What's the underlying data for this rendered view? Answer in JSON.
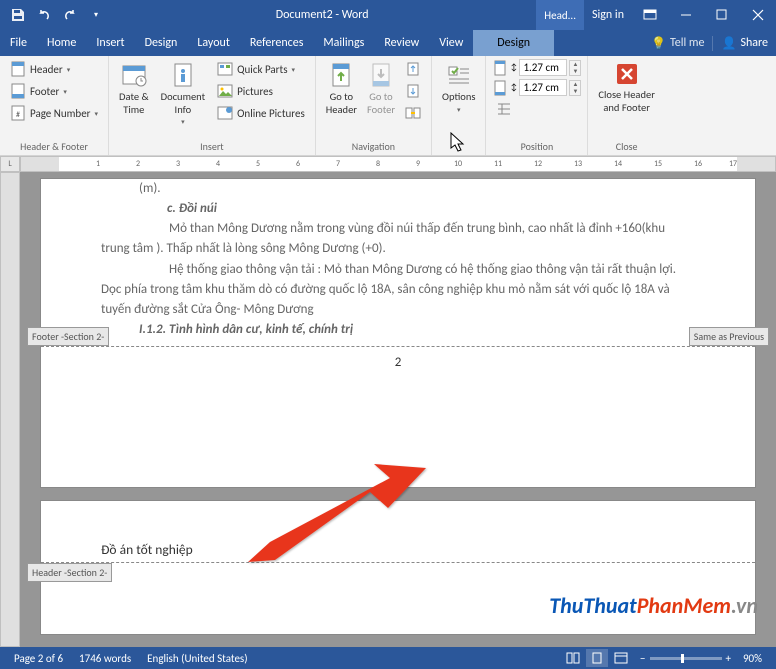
{
  "titlebar": {
    "document_title": "Document2 - Word",
    "contextual_tab": "Head...",
    "sign_in": "Sign in"
  },
  "menu": {
    "file": "File",
    "home": "Home",
    "insert": "Insert",
    "design": "Design",
    "layout": "Layout",
    "references": "References",
    "mailings": "Mailings",
    "review": "Review",
    "view": "View",
    "hf_design": "Design",
    "tell_me": "Tell me",
    "share": "Share"
  },
  "ribbon": {
    "hf": {
      "header": "Header",
      "footer": "Footer",
      "page_number": "Page Number",
      "group": "Header & Footer"
    },
    "insert": {
      "date_time": "Date &\nTime",
      "doc_info": "Document\nInfo",
      "quick_parts": "Quick Parts",
      "pictures": "Pictures",
      "online_pictures": "Online Pictures",
      "group": "Insert"
    },
    "nav": {
      "goto_header": "Go to\nHeader",
      "goto_footer": "Go to\nFooter",
      "group": "Navigation"
    },
    "options": {
      "label": "Options",
      "group": ""
    },
    "position": {
      "top": "1.27 cm",
      "bottom": "1.27 cm",
      "group": "Position"
    },
    "close": {
      "label": "Close Header\nand Footer",
      "group": "Close"
    }
  },
  "document": {
    "body": {
      "line_m": "(m).",
      "heading_c": "c. Đồi núi",
      "para1": "Mỏ than Mông Dương nằm trong vùng đồi núi thấp đến trung bình, cao nhất là đỉnh +160(khu trung tâm ). Thấp nhất là lòng sông Mông Dương (+0).",
      "para2": "Hệ thống giao thông vận tải : Mỏ than Mông Dương có hệ thống giao thông vận tải rất thuận lợi. Dọc phía trong tâm khu thăm dò có đường quốc lộ 18A, sân công nghiệp khu mỏ nằm sát với quốc lộ 18A và tuyến đường sắt Cửa Ông- Mông Dương",
      "heading_112": "I.1.2.  Tình hình dân cư, kinh tế, chính trị"
    },
    "footer": {
      "label": "Footer -Section 2-",
      "same_as_previous": "Same as Previous",
      "page_number": "2"
    },
    "header": {
      "text": "Đồ án tốt nghiệp",
      "label": "Header -Section 2-"
    }
  },
  "statusbar": {
    "page": "Page 2 of 6",
    "words": "1746 words",
    "language": "English (United States)",
    "zoom": "90%"
  },
  "watermark": {
    "t1": "ThuThuat",
    "t2": "PhanMem",
    "t3": ".vn"
  }
}
